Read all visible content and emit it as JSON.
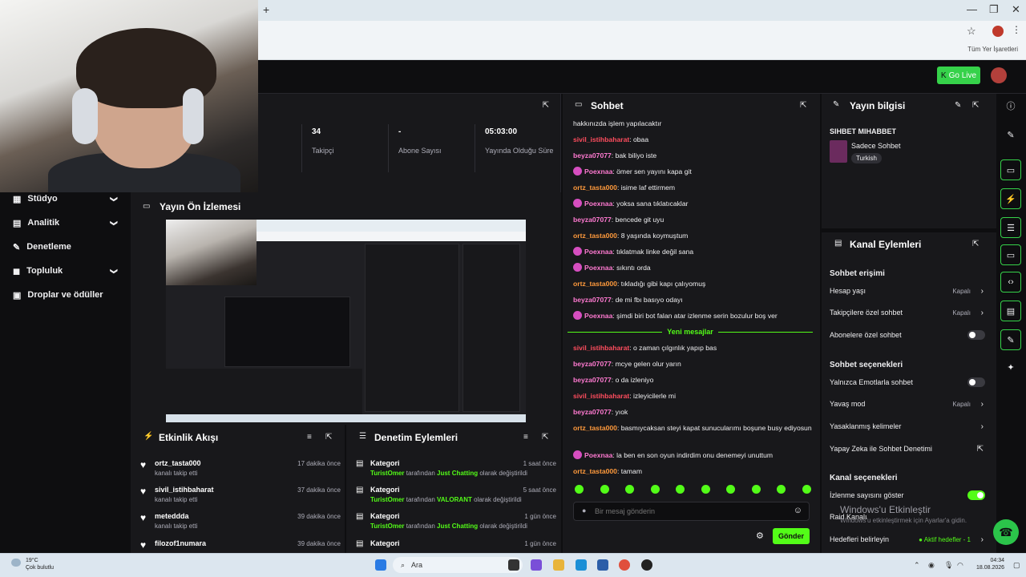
{
  "browser": {
    "new_tab": "+",
    "bookmarks_label": "Tüm Yer İşaretleri",
    "minimize": "—",
    "restore": "❐",
    "close": "✕",
    "star": "☆"
  },
  "header": {
    "go_live": "Go Live"
  },
  "stats": [
    {
      "value": "34",
      "label": "Takipçi"
    },
    {
      "value": "-",
      "label": "Abone Sayısı"
    },
    {
      "value": "05:03:00",
      "label": "Yayında Olduğu Süre"
    }
  ],
  "sidebar": {
    "items": [
      {
        "label": "Stüdyo",
        "chevron": "❯"
      },
      {
        "label": "Analitik",
        "chevron": "❯"
      },
      {
        "label": "Denetleme",
        "chevron": ""
      },
      {
        "label": "Topluluk",
        "chevron": "❯"
      },
      {
        "label": "Droplar ve ödüller",
        "chevron": ""
      }
    ]
  },
  "preview": {
    "title": "Yayın Ön İzlemesi"
  },
  "activity": {
    "title": "Etkinlik Akışı",
    "items": [
      {
        "name": "ortz_tasta000",
        "sub": "kanalı takip etti",
        "time": "17 dakika önce"
      },
      {
        "name": "sivil_istihbaharat",
        "sub": "kanalı takip etti",
        "time": "37 dakika önce"
      },
      {
        "name": "meteddda",
        "sub": "kanalı takip etti",
        "time": "39 dakika önce"
      },
      {
        "name": "filozof1numara",
        "sub": "",
        "time": "39 dakika önce"
      }
    ]
  },
  "audit": {
    "title": "Denetim Eylemleri",
    "items": [
      {
        "title": "Kategori",
        "user": "TuristOmer",
        "mid": " tarafından ",
        "cat": "Just Chatting",
        "end": " olarak değiştirildi",
        "time": "1 saat önce"
      },
      {
        "title": "Kategori",
        "user": "TuristOmer",
        "mid": " tarafından ",
        "cat": "VALORANT",
        "end": " olarak değiştirildi",
        "time": "5 saat önce"
      },
      {
        "title": "Kategori",
        "user": "TuristOmer",
        "mid": " tarafından ",
        "cat": "Just Chatting",
        "end": " olarak değiştirildi",
        "time": "1 gün önce"
      },
      {
        "title": "Kategori",
        "user": "",
        "mid": "",
        "cat": "",
        "end": "",
        "time": "1 gün önce"
      }
    ]
  },
  "chat": {
    "title": "Sohbet",
    "new_messages": "Yeni mesajlar",
    "input_placeholder": "Bir mesaj gönderin",
    "send": "Gönder",
    "messages": [
      {
        "user": "",
        "color": "#efeff1",
        "badge": false,
        "text": "hakkınızda işlem yapılacaktır"
      },
      {
        "user": "sivil_istihbaharat",
        "color": "#ff4d5e",
        "badge": false,
        "text": "obaa"
      },
      {
        "user": "beyza07077",
        "color": "#ff7ad1",
        "badge": false,
        "text": "bak biliyo iste"
      },
      {
        "user": "Poexnaa",
        "color": "#ff7ad1",
        "badge": true,
        "text": "ömer sen yayını kapa git"
      },
      {
        "user": "ortz_tasta000",
        "color": "#ff9a3c",
        "badge": false,
        "text": "isime laf ettirmem"
      },
      {
        "user": "Poexnaa",
        "color": "#ff7ad1",
        "badge": true,
        "text": "yoksa sana tıklatıcaklar"
      },
      {
        "user": "beyza07077",
        "color": "#ff7ad1",
        "badge": false,
        "text": "bencede git uyu"
      },
      {
        "user": "ortz_tasta000",
        "color": "#ff9a3c",
        "badge": false,
        "text": "8 yaşında koymuştum"
      },
      {
        "user": "Poexnaa",
        "color": "#ff7ad1",
        "badge": true,
        "text": "tıklatmak linke değil sana"
      },
      {
        "user": "Poexnaa",
        "color": "#ff7ad1",
        "badge": true,
        "text": "sıkıntı orda"
      },
      {
        "user": "ortz_tasta000",
        "color": "#ff9a3c",
        "badge": false,
        "text": "tıkladığı gibi kapı çalıyomuş"
      },
      {
        "user": "beyza07077",
        "color": "#ff7ad1",
        "badge": false,
        "text": "de mi fbı basıyo odayı"
      },
      {
        "user": "Poexnaa",
        "color": "#ff7ad1",
        "badge": true,
        "text": "şimdi biri bot falan atar izlenme serin bozulur boş ver"
      },
      {
        "user": "sivil_istihbaharat",
        "color": "#ff4d5e",
        "badge": false,
        "text": "o zaman çılgınlık yapıp bas"
      },
      {
        "user": "beyza07077",
        "color": "#ff7ad1",
        "badge": false,
        "text": "mcye gelen olur yarın"
      },
      {
        "user": "beyza07077",
        "color": "#ff7ad1",
        "badge": false,
        "text": "o da izleniyo"
      },
      {
        "user": "sivil_istihbaharat",
        "color": "#ff4d5e",
        "badge": false,
        "text": "izleyicilerle mi"
      },
      {
        "user": "beyza07077",
        "color": "#ff7ad1",
        "badge": false,
        "text": "yıok"
      },
      {
        "user": "ortz_tasta000",
        "color": "#ff9a3c",
        "badge": false,
        "text": "basmıycaksan steyi kapat sunucularımı boşune busy ediyosun"
      },
      {
        "user": "Poexnaa",
        "color": "#ff7ad1",
        "badge": true,
        "text": "la ben en son oyun indirdim onu denemeyi unuttum"
      },
      {
        "user": "ortz_tasta000",
        "color": "#ff9a3c",
        "badge": false,
        "text": "tamam"
      }
    ]
  },
  "stream_info": {
    "title": "Yayın bilgisi",
    "stream_title": "SIHBET MIHABBET",
    "category": "Sadece Sohbet",
    "language": "Turkish"
  },
  "channel_actions": {
    "title": "Kanal Eylemleri",
    "sections": [
      {
        "heading": "Sohbet erişimi",
        "rows": [
          {
            "label": "Hesap yaşı",
            "value": "Kapalı",
            "kind": "arrow"
          },
          {
            "label": "Takipçilere özel sohbet",
            "value": "Kapalı",
            "kind": "arrow"
          },
          {
            "label": "Abonelere özel sohbet",
            "value": "",
            "kind": "toggle-off"
          }
        ]
      },
      {
        "heading": "Sohbet seçenekleri",
        "rows": [
          {
            "label": "Yalnızca Emotlarla sohbet",
            "value": "",
            "kind": "toggle-off"
          },
          {
            "label": "Yavaş mod",
            "value": "Kapalı",
            "kind": "arrow"
          },
          {
            "label": "Yasaklanmış kelimeler",
            "value": "",
            "kind": "arrow"
          },
          {
            "label": "Yapay Zeka ile Sohbet Denetimi",
            "value": "",
            "kind": "external"
          }
        ]
      },
      {
        "heading": "Kanal seçenekleri",
        "rows": [
          {
            "label": "İzlenme sayısını göster",
            "value": "",
            "kind": "toggle-on"
          },
          {
            "label": "Raid Kanalı",
            "value": "",
            "kind": "none"
          },
          {
            "label": "Hedefleri belirleyin",
            "value": "● Aktif hedefler - 1",
            "kind": "arrow"
          }
        ]
      }
    ]
  },
  "watermark": {
    "line1": "Windows'u Etkinleştir",
    "line2": "Windows'u etkinleştirmek için Ayarlar'a gidin."
  },
  "taskbar": {
    "temp": "19°C",
    "weather": "Çok bulutlu",
    "search": "Ara",
    "time": "04:34",
    "date": "18.08.2026"
  },
  "colors": {
    "accent": "#53fc18",
    "bg": "#0e0e10",
    "panel": "#18181b"
  }
}
